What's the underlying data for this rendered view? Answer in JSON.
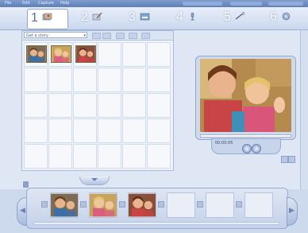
{
  "menubar": {
    "items": [
      "File",
      "Edit",
      "Capture",
      "Help"
    ]
  },
  "steps": [
    {
      "num": "1",
      "icon": "import-photos-icon",
      "active": true
    },
    {
      "num": "2",
      "icon": "edit-photos-icon",
      "active": false
    },
    {
      "num": "3",
      "icon": "add-titles-icon",
      "active": false
    },
    {
      "num": "4",
      "icon": "narration-icon",
      "active": false
    },
    {
      "num": "5",
      "icon": "customize-motion-icon",
      "active": false
    },
    {
      "num": "6",
      "icon": "save-project-icon",
      "active": false
    }
  ],
  "grid": {
    "dropdown_label": "Get a story",
    "columns": 6,
    "rows": 5,
    "thumbnails": [
      "kids-photo-1",
      "kids-photo-2",
      "kids-photo-3"
    ]
  },
  "preview": {
    "time": "00:00:05",
    "subject": "children waving"
  },
  "storyboard": {
    "slots": [
      "kids-photo-1",
      "kids-photo-2",
      "kids-photo-3",
      "",
      "",
      ""
    ]
  },
  "colors": {
    "accent": "#5072b3",
    "background": "#cdd9ec"
  }
}
